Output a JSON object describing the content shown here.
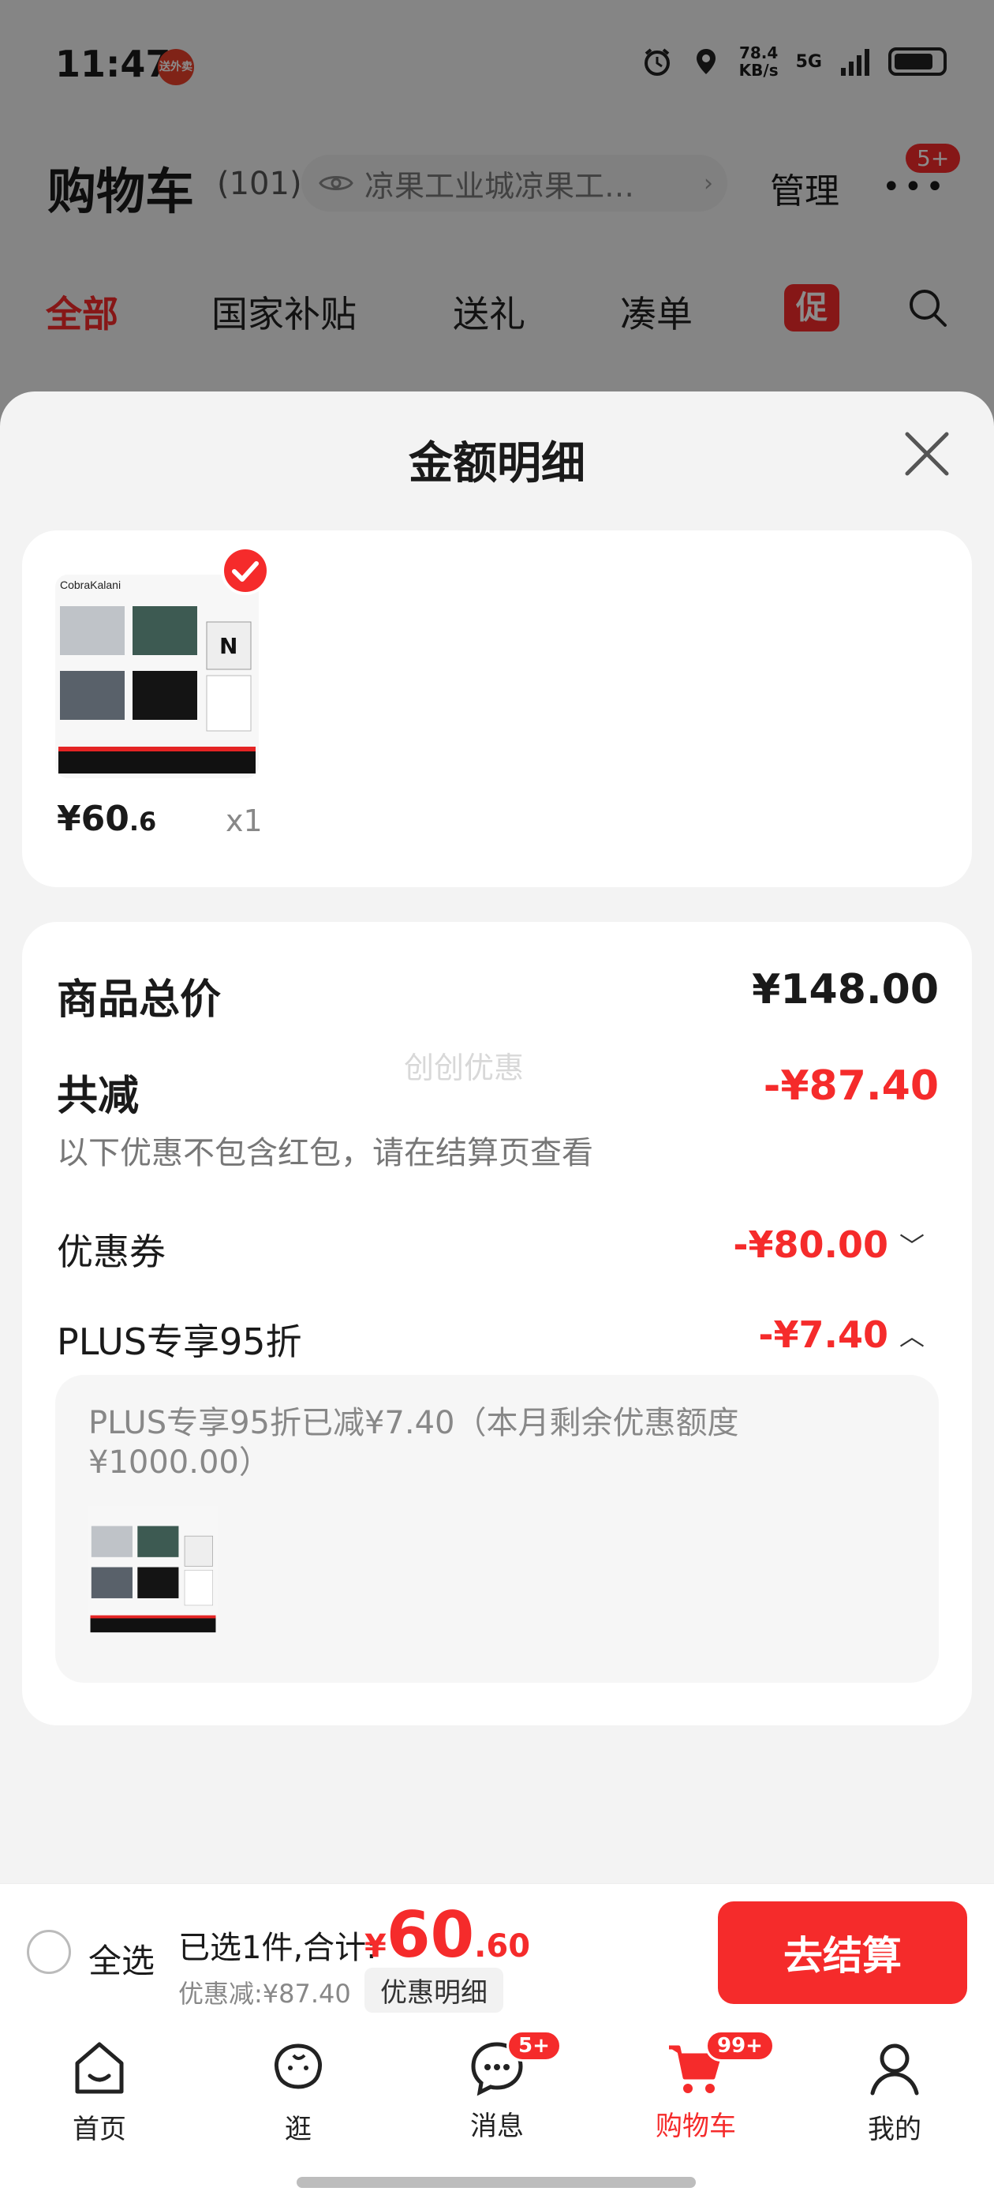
{
  "status_bar": {
    "time": "11:47",
    "app_badge": "送外卖",
    "net_speed": "78.4",
    "net_unit": "KB/s",
    "network": "5G"
  },
  "header": {
    "title": "购物车",
    "count": "(101)",
    "address": "凉果工业城凉果工…",
    "manage": "管理",
    "menu_badge": "5+"
  },
  "tabs": [
    {
      "label": "全部"
    },
    {
      "label": "国家补贴"
    },
    {
      "label": "送礼"
    },
    {
      "label": "凑单"
    }
  ],
  "promo_chip": "促",
  "sheet": {
    "title": "金额明细",
    "product": {
      "brand": "CobraKalani",
      "price_int": "¥60",
      "price_dec": ".6",
      "qty": "x1"
    },
    "total": {
      "label": "商品总价",
      "value": "¥148.00"
    },
    "reduction": {
      "label": "共减",
      "value": "-¥87.40",
      "note": "以下优惠不包含红包，请在结算页查看",
      "watermark": "创创优惠"
    },
    "coupon": {
      "label": "优惠券",
      "value": "-¥80.00"
    },
    "plus": {
      "label": "PLUS专享95折",
      "value": "-¥7.40",
      "detail": "PLUS专享95折已减¥7.40（本月剩余优惠额度¥1000.00）"
    }
  },
  "checkout": {
    "select_all": "全选",
    "selected": "已选1件,合计:",
    "currency": "¥",
    "amount_int": "60",
    "amount_dec": ".60",
    "discount": "优惠减:¥87.40",
    "detail_link": "优惠明细",
    "button": "去结算"
  },
  "tabbar": [
    {
      "label": "首页",
      "icon": "home-icon"
    },
    {
      "label": "逛",
      "icon": "browse-icon"
    },
    {
      "label": "消息",
      "icon": "message-icon",
      "badge": "5+"
    },
    {
      "label": "购物车",
      "icon": "cart-icon",
      "badge": "99+"
    },
    {
      "label": "我的",
      "icon": "profile-icon"
    }
  ],
  "colors": {
    "accent": "#f52b2b",
    "sheet_bg": "#f3f3f3",
    "card_bg": "#ffffff"
  }
}
